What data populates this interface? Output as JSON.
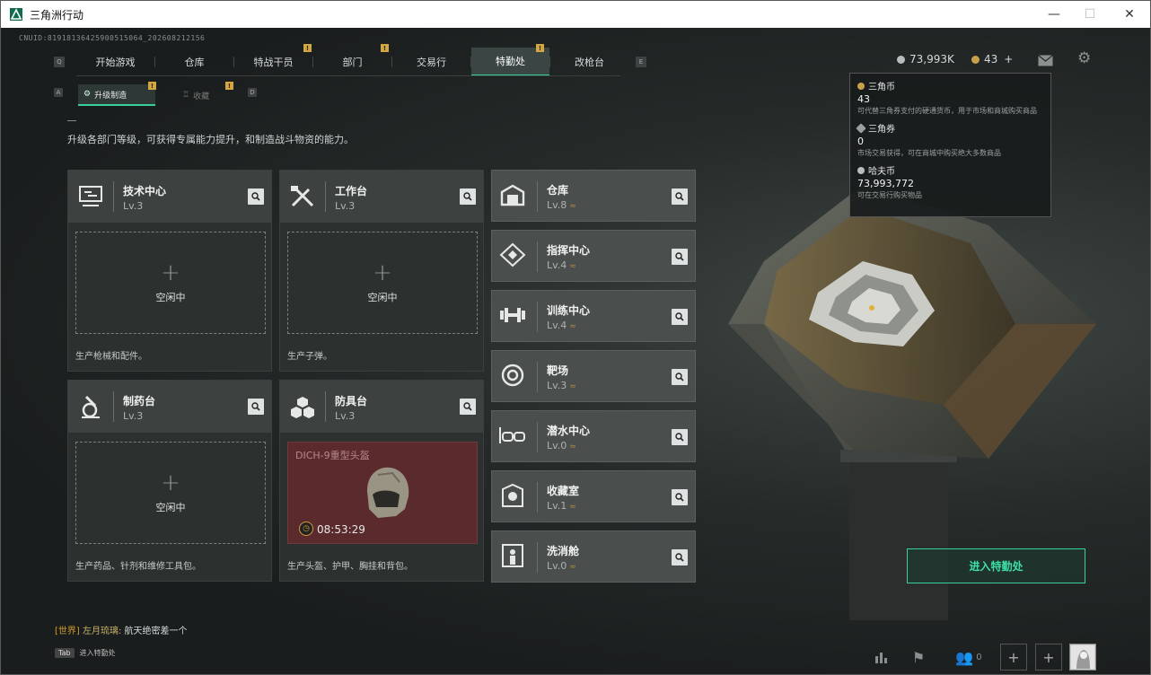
{
  "window": {
    "title": "三角洲行动",
    "minimize": "—",
    "maximize": "☐",
    "close": "✕"
  },
  "cnuid": "CNUID:81918136425900515064_202608212156",
  "nav": {
    "left_key": "Q",
    "right_key": "E",
    "tabs": [
      {
        "label": "开始游戏",
        "badge": ""
      },
      {
        "label": "仓库",
        "badge": ""
      },
      {
        "label": "特战干员",
        "badge": "!"
      },
      {
        "label": "部门",
        "badge": "!"
      },
      {
        "label": "交易行",
        "badge": ""
      },
      {
        "label": "特勤处",
        "badge": "!"
      },
      {
        "label": "改枪台",
        "badge": ""
      }
    ],
    "active_tab": "特勤处"
  },
  "subnav": {
    "left_key": "A",
    "right_key": "D",
    "tabs": [
      {
        "label": "升级制造",
        "badge": "!"
      },
      {
        "label": "收藏",
        "badge": "!"
      }
    ]
  },
  "description": "升级各部门等级，可获得专属能力提升，和制造战斗物资的能力。",
  "workshops": [
    {
      "name": "技术中心",
      "level": "Lv.3",
      "status": "空闲中",
      "footer": "生产枪械和配件。",
      "icon": "tech-center-icon"
    },
    {
      "name": "工作台",
      "level": "Lv.3",
      "status": "空闲中",
      "footer": "生产子弹。",
      "icon": "workbench-icon"
    },
    {
      "name": "制药台",
      "level": "Lv.3",
      "status": "空闲中",
      "footer": "生产药品、针剂和维修工具包。",
      "icon": "pharmacy-icon"
    },
    {
      "name": "防具台",
      "level": "Lv.3",
      "status": "",
      "footer": "生产头盔、护甲、胸挂和背包。",
      "icon": "armor-icon",
      "production": {
        "item": "DICH-9重型头盔",
        "time": "08:53:29"
      }
    }
  ],
  "facilities": [
    {
      "name": "仓库",
      "level": "Lv.8",
      "up": "≈",
      "icon": "warehouse-icon"
    },
    {
      "name": "指挥中心",
      "level": "Lv.4",
      "up": "≈",
      "icon": "command-center-icon"
    },
    {
      "name": "训练中心",
      "level": "Lv.4",
      "up": "≈",
      "icon": "dumbbell-icon"
    },
    {
      "name": "靶场",
      "level": "Lv.3",
      "up": "≈",
      "icon": "target-icon"
    },
    {
      "name": "潜水中心",
      "level": "Lv.0",
      "up": "≈",
      "icon": "diving-goggles-icon"
    },
    {
      "name": "收藏室",
      "level": "Lv.1",
      "up": "≈",
      "icon": "collection-room-icon"
    },
    {
      "name": "洗消舱",
      "level": "Lv.0",
      "up": "≈",
      "icon": "decontamination-icon"
    }
  ],
  "currency": {
    "hafcoin_short": "73,993K",
    "tricoin_short": "43",
    "plus": "+"
  },
  "tooltip": {
    "items": [
      {
        "name": "三角币",
        "value": "43",
        "desc": "可代替三角券支付的硬通货币，用于市场和商城购买商品",
        "color": "#c8a04a"
      },
      {
        "name": "三角券",
        "value": "0",
        "desc": "市场交易获得，可在商城中购买绝大多数商品",
        "color": "#9aa09f"
      },
      {
        "name": "哈夫币",
        "value": "73,993,772",
        "desc": "可在交易行购买物品",
        "color": "#b9bdbd"
      }
    ]
  },
  "enter_button": "进入特勤处",
  "chat": {
    "channel": "[世界]",
    "user": "左月琉璃:",
    "message": " 航天绝密差一个"
  },
  "tab_hint": {
    "key": "Tab",
    "label": "进入特勤处"
  },
  "bottom_bar": {
    "friends_count": "0"
  }
}
